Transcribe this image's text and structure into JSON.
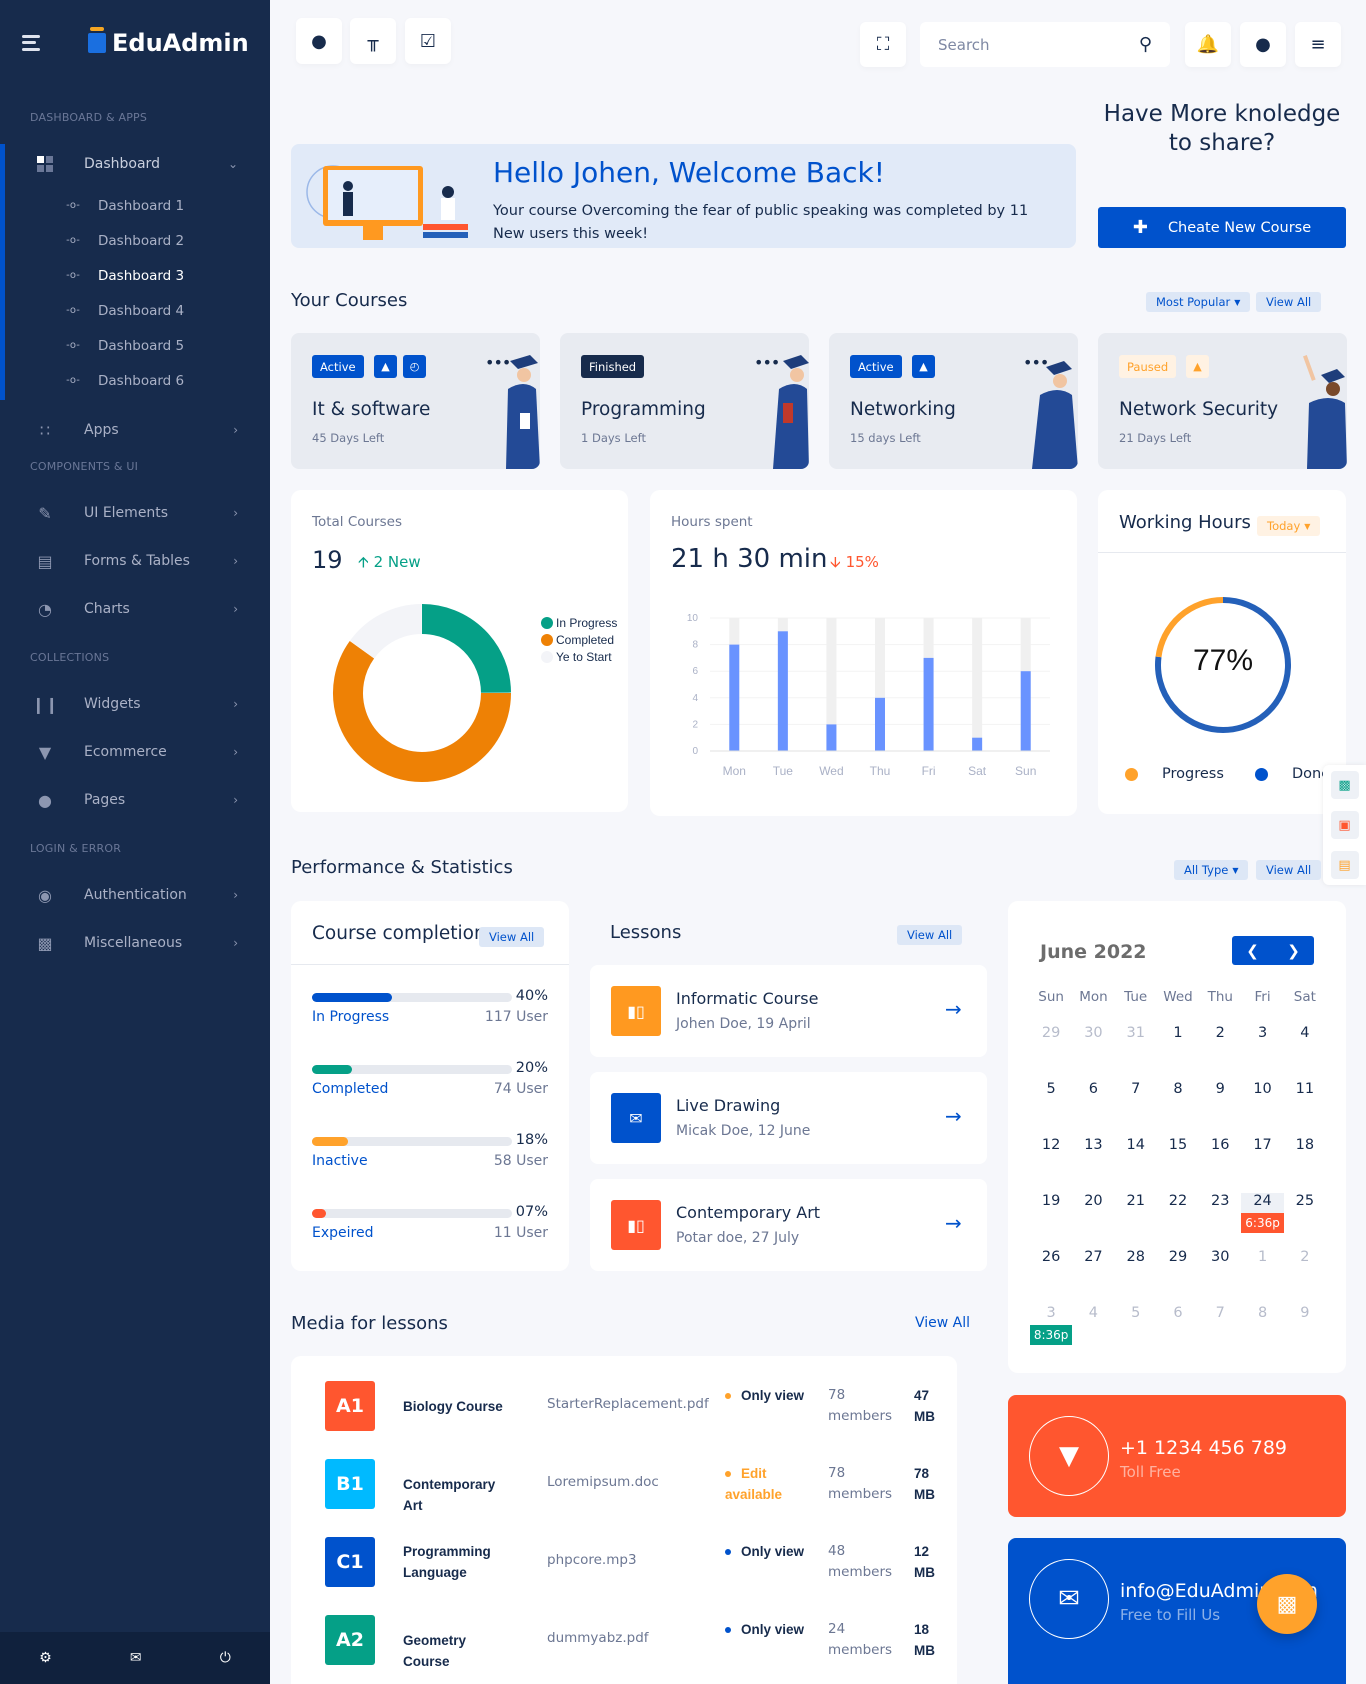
{
  "sidebar": {
    "brand": "EduAdmin",
    "sections": {
      "dashboard_apps": "DASHBOARD & APPS",
      "components_ui": "COMPONENTS & UI",
      "collections": "COLLECTIONS",
      "login_error": "LOGIN & ERROR"
    },
    "dashboard": {
      "label": "Dashboard",
      "icon": "grid-icon"
    },
    "sub_items": [
      "Dashboard 1",
      "Dashboard 2",
      "Dashboard 3",
      "Dashboard 4",
      "Dashboard 5",
      "Dashboard 6"
    ],
    "current_sub": "Dashboard 3",
    "items": {
      "apps": "Apps",
      "ui_elements": "UI Elements",
      "forms_tables": "Forms & Tables",
      "charts": "Charts",
      "widgets": "Widgets",
      "ecommerce": "Ecommerce",
      "pages": "Pages",
      "authentication": "Authentication",
      "miscellaneous": "Miscellaneous"
    },
    "bottom_icons": [
      "settings-icon",
      "mail-icon",
      "power-icon"
    ]
  },
  "topbar": {
    "left_icons": [
      "chat-icon",
      "signpost-icon",
      "clipboard-check-icon"
    ],
    "search_placeholder": "Search",
    "right_icons": [
      "fullscreen-icon",
      "bell-icon",
      "user-icon",
      "settings-toggle-icon"
    ]
  },
  "welcome": {
    "title": "Hello Johen, Welcome Back!",
    "message": "Your course Overcoming the fear of public speaking was completed by 11 New users this week!"
  },
  "share": {
    "text": "Have More knoledge to share?",
    "button": "Cheate New Course"
  },
  "courses": {
    "title": "Your Courses",
    "filter": "Most Popular",
    "view_all": "View All",
    "items": [
      {
        "status": "Active",
        "title": "It & software",
        "days": "45 Days Left",
        "icons": [
          "lock-icon",
          "clock-icon"
        ]
      },
      {
        "status": "Finished",
        "title": "Programming",
        "days": "1 Days Left",
        "icons": []
      },
      {
        "status": "Active",
        "title": "Networking",
        "days": "15 days Left",
        "icons": [
          "lock-icon"
        ]
      },
      {
        "status": "Paused",
        "title": "Network Security",
        "days": "21 Days Left",
        "icons": [
          "lock-icon"
        ]
      }
    ]
  },
  "total_courses": {
    "label": "Total Courses",
    "value": "19",
    "new": "2 New"
  },
  "hours_spent": {
    "label": "Hours spent",
    "value": "21 h 30 min",
    "change": "15%"
  },
  "working_hours": {
    "title": "Working Hours",
    "filter": "Today",
    "value": "77%",
    "legend": [
      "Progress",
      "Done"
    ]
  },
  "chart_data": [
    {
      "type": "pie",
      "title": "Total Courses",
      "donut": true,
      "categories": [
        "In Progress",
        "Completed",
        "Ye to Start"
      ],
      "values": [
        25,
        60,
        15
      ],
      "colors": [
        "#05a087",
        "#ee8105",
        "#f3f4f8"
      ],
      "legend": "right"
    },
    {
      "type": "bar",
      "title": "Hours spent",
      "categories": [
        "Mon",
        "Tue",
        "Wed",
        "Thu",
        "Fri",
        "Sat",
        "Sun"
      ],
      "series": [
        {
          "name": "Hours",
          "values": [
            8,
            9,
            2,
            4,
            7,
            1,
            6
          ]
        }
      ],
      "max_background": 10,
      "ylim": [
        0,
        10
      ],
      "yticks": [
        0,
        2,
        4,
        6,
        8,
        10
      ],
      "grid": true,
      "colors": {
        "bar": "#6993ff",
        "track": "#f0f0f0"
      }
    },
    {
      "type": "pie",
      "title": "Working Hours",
      "donut": true,
      "categories": [
        "Progress",
        "Done"
      ],
      "values": [
        23,
        77
      ],
      "colors": [
        "#ffa22b",
        "#2460b9"
      ],
      "center_label": "77%"
    }
  ],
  "performance": {
    "title": "Performance & Statistics",
    "filter": "All Type",
    "view_all": "View All"
  },
  "course_completion": {
    "title": "Course completion",
    "view_all": "View All",
    "rows": [
      {
        "name": "In Progress",
        "pct": "40%",
        "value": 40,
        "users": "117 User",
        "color": "#0052cc"
      },
      {
        "name": "Completed",
        "pct": "20%",
        "value": 20,
        "users": "74 User",
        "color": "#05a087"
      },
      {
        "name": "Inactive",
        "pct": "18%",
        "value": 18,
        "users": "58 User",
        "color": "#ffa22b"
      },
      {
        "name": "Expeired",
        "pct": "07%",
        "value": 7,
        "users": "11 User",
        "color": "#ff562f"
      }
    ]
  },
  "lessons": {
    "title": "Lessons",
    "view_all": "View All",
    "items": [
      {
        "title": "Informatic Course",
        "subtitle": "Johen Doe, 19 April",
        "icon": "book-icon",
        "color": "#ff9920"
      },
      {
        "title": "Live Drawing",
        "subtitle": "Micak Doe, 12 June",
        "icon": "mail-icon",
        "color": "#0052cc"
      },
      {
        "title": "Contemporary Art",
        "subtitle": "Potar doe, 27 July",
        "icon": "book-icon",
        "color": "#ff562f"
      }
    ]
  },
  "calendar": {
    "title": "June 2022",
    "days_of_week": [
      "Sun",
      "Mon",
      "Tue",
      "Wed",
      "Thu",
      "Fri",
      "Sat"
    ],
    "weeks": [
      [
        "29",
        "30",
        "31",
        "1",
        "2",
        "3",
        "4"
      ],
      [
        "5",
        "6",
        "7",
        "8",
        "9",
        "10",
        "11"
      ],
      [
        "12",
        "13",
        "14",
        "15",
        "16",
        "17",
        "18"
      ],
      [
        "19",
        "20",
        "21",
        "22",
        "23",
        "24",
        "25"
      ],
      [
        "26",
        "27",
        "28",
        "29",
        "30",
        "1",
        "2"
      ],
      [
        "3",
        "4",
        "5",
        "6",
        "7",
        "8",
        "9"
      ]
    ],
    "events": [
      {
        "label": "6:36p",
        "color": "#ff562f"
      },
      {
        "label": "8:36p",
        "color": "#05a087"
      }
    ]
  },
  "media": {
    "title": "Media for lessons",
    "view_all": "View All",
    "rows": [
      {
        "code": "A1",
        "color": "#ff562f",
        "name": "Biology Course",
        "file": "StarterReplacement.pdf",
        "status": "Only view",
        "status_color": "#ffa22b",
        "status_text_color": "#172b4c",
        "members": "78 members",
        "size": "47 MB"
      },
      {
        "code": "B1",
        "color": "#00baff",
        "name": "Contemporary Art",
        "file": "Loremipsum.doc",
        "status": "Edit available",
        "status_color": "#ffa22b",
        "status_text_color": "#ffa22b",
        "members": "78 members",
        "size": "78 MB"
      },
      {
        "code": "C1",
        "color": "#0052cc",
        "name": "Programming Language",
        "file": "phpcore.mp3",
        "status": "Only view",
        "status_color": "#0052cc",
        "status_text_color": "#172b4c",
        "members": "48 members",
        "size": "12 MB"
      },
      {
        "code": "A2",
        "color": "#05a087",
        "name": "Geometry Course",
        "file": "dummyabz.pdf",
        "status": "Only view",
        "status_color": "#0052cc",
        "status_text_color": "#172b4c",
        "members": "24 members",
        "size": "18 MB"
      }
    ]
  },
  "contacts": {
    "phone": "+1 1234 456 789",
    "phone_sub": "Toll Free",
    "email": "info@EduAdmin.com",
    "email_sub": "Free to Fill Us"
  }
}
